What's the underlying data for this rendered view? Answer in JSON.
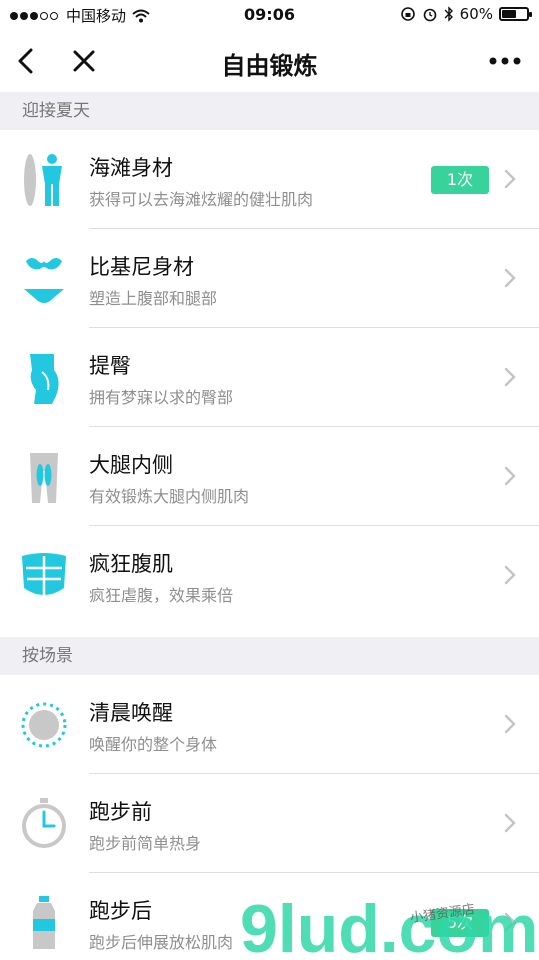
{
  "status_bar": {
    "carrier": "中国移动",
    "time": "09:06",
    "battery_percent": "60%",
    "battery_level": 0.6,
    "signal_dots_filled": 3,
    "signal_dots_total": 5
  },
  "nav": {
    "title": "自由锻炼",
    "back_icon": "chevron-left-icon",
    "close_icon": "close-icon",
    "more_icon": "more-dots-icon"
  },
  "sections": [
    {
      "header": "迎接夏天",
      "items": [
        {
          "title": "海滩身材",
          "subtitle": "获得可以去海滩炫耀的健壮肌肉",
          "badge": "1次",
          "icon": "surfboard-body-icon"
        },
        {
          "title": "比基尼身材",
          "subtitle": "塑造上腹部和腿部",
          "badge": "",
          "icon": "bikini-icon"
        },
        {
          "title": "提臀",
          "subtitle": "拥有梦寐以求的臀部",
          "badge": "",
          "icon": "glutes-icon"
        },
        {
          "title": "大腿内侧",
          "subtitle": "有效锻炼大腿内侧肌肉",
          "badge": "",
          "icon": "inner-thigh-icon"
        },
        {
          "title": "疯狂腹肌",
          "subtitle": "疯狂虐腹，效果乘倍",
          "badge": "",
          "icon": "abs-icon"
        }
      ]
    },
    {
      "header": "按场景",
      "items": [
        {
          "title": "清晨唤醒",
          "subtitle": "唤醒你的整个身体",
          "badge": "",
          "icon": "sun-icon"
        },
        {
          "title": "跑步前",
          "subtitle": "跑步前简单热身",
          "badge": "",
          "icon": "stopwatch-icon"
        },
        {
          "title": "跑步后",
          "subtitle": "跑步后伸展放松肌肉",
          "badge": "5次",
          "icon": "water-bottle-icon"
        }
      ]
    }
  ],
  "colors": {
    "accent_cyan": "#22c8e0",
    "badge_green": "#37d39a",
    "icon_gray": "#c8c8c8",
    "section_bg": "#efeff4"
  },
  "watermark": {
    "text": "9lud.com",
    "small_text": "小猪资源店"
  }
}
